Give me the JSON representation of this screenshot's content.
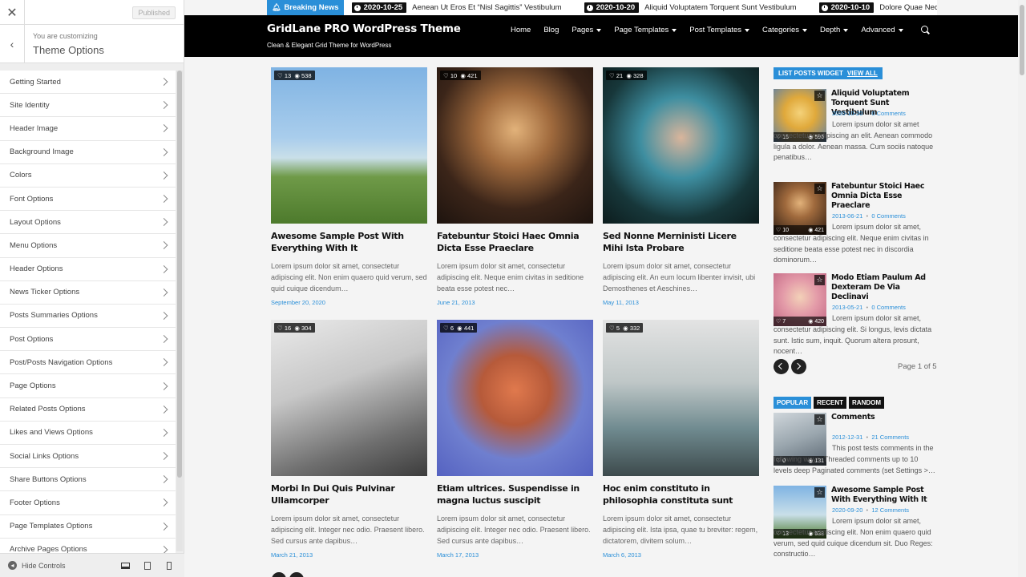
{
  "customizer": {
    "published_label": "Published",
    "subtitle": "You are customizing",
    "title": "Theme Options",
    "items": [
      "Getting Started",
      "Site Identity",
      "Header Image",
      "Background Image",
      "Colors",
      "Font Options",
      "Layout Options",
      "Menu Options",
      "Header Options",
      "News Ticker Options",
      "Posts Summaries Options",
      "Post Options",
      "Post/Posts Navigation Options",
      "Page Options",
      "Related Posts Options",
      "Likes and Views Options",
      "Social Links Options",
      "Share Buttons Options",
      "Footer Options",
      "Page Templates Options",
      "Archive Pages Options"
    ],
    "hide_controls": "Hide Controls"
  },
  "ticker": {
    "label": "Breaking News",
    "entries": [
      {
        "date": "2020-10-25",
        "text": "Aenean Ut Eros Et “Nisl Sagittis” Vestibulum"
      },
      {
        "date": "2020-10-20",
        "text": "Aliquid Voluptatem Torquent Sunt Vestibulum"
      },
      {
        "date": "2020-10-10",
        "text": "Dolore Quae Nec"
      }
    ]
  },
  "site": {
    "title": "GridLane PRO WordPress Theme",
    "description": "Clean & Elegant Grid Theme for WordPress"
  },
  "nav": [
    {
      "label": "Home",
      "dropdown": false
    },
    {
      "label": "Blog",
      "dropdown": false
    },
    {
      "label": "Pages",
      "dropdown": true
    },
    {
      "label": "Page Templates",
      "dropdown": true
    },
    {
      "label": "Post Templates",
      "dropdown": true
    },
    {
      "label": "Categories",
      "dropdown": true
    },
    {
      "label": "Depth",
      "dropdown": true
    },
    {
      "label": "Advanced",
      "dropdown": true
    }
  ],
  "posts": [
    {
      "likes": "13",
      "views": "538",
      "title": "Awesome Sample Post With Everything With It",
      "excerpt": "Lorem ipsum dolor sit amet, consectetur adipiscing elit. Non enim quaero quid verum, sed quid cuique dicendum…",
      "date": "September 20, 2020"
    },
    {
      "likes": "10",
      "views": "421",
      "title": "Fatebuntur Stoici Haec Omnia Dicta Esse Praeclare",
      "excerpt": "Lorem ipsum dolor sit amet, consectetur adipiscing elit. Neque enim civitas in seditione beata esse potest nec…",
      "date": "June 21, 2013"
    },
    {
      "likes": "21",
      "views": "328",
      "title": "Sed Nonne Merninisti Licere Mihi Ista Probare",
      "excerpt": "Lorem ipsum dolor sit amet, consectetur adipiscing elit. An eum locum libenter invisit, ubi Demosthenes et Aeschines…",
      "date": "May 11, 2013"
    },
    {
      "likes": "16",
      "views": "304",
      "title": "Morbi In Dui Quis Pulvinar Ullamcorper",
      "excerpt": "Lorem ipsum dolor sit amet, consectetur adipiscing elit. Integer nec odio. Praesent libero. Sed cursus ante dapibus…",
      "date": "March 21, 2013"
    },
    {
      "likes": "6",
      "views": "441",
      "title": "Etiam ultrices. Suspendisse in magna luctus suscipit",
      "excerpt": "Lorem ipsum dolor sit amet, consectetur adipiscing elit. Integer nec odio. Praesent libero. Sed cursus ante dapibus…",
      "date": "March 17, 2013"
    },
    {
      "likes": "5",
      "views": "332",
      "title": "Hoc enim constituto in philosophia constituta sunt",
      "excerpt": "Lorem ipsum dolor sit amet, consectetur adipiscing elit. Ista ipsa, quae tu breviter: regem, dictatorem, divitem solum…",
      "date": "March 6, 2013"
    }
  ],
  "sidebar": {
    "widget_title": "LIST POSTS WIDGET",
    "view_all": "VIEW ALL",
    "list": [
      {
        "likes": "15",
        "views": "596",
        "title": "Aliquid Voluptatem Torquent Sunt Vestibulum",
        "date": "2020-10-20",
        "comments": "0 Comments",
        "excerpt": "Lorem ipsum dolor sit amet consectetuer adipiscing an elit. Aenean commodo ligula a dolor. Aenean massa. Cum sociis natoque penatibus…"
      },
      {
        "likes": "10",
        "views": "421",
        "title": "Fatebuntur Stoici Haec Omnia Dicta Esse Praeclare",
        "date": "2013-06-21",
        "comments": "0 Comments",
        "excerpt": "Lorem ipsum dolor sit amet, consectetur adipiscing elit. Neque enim civitas in seditione beata esse potest nec in discordia dominorum…"
      },
      {
        "likes": "7",
        "views": "420",
        "title": "Modo Etiam Paulum Ad Dexteram De Via Declinavi",
        "date": "2013-05-21",
        "comments": "0 Comments",
        "excerpt": "Lorem ipsum dolor sit amet, consectetur adipiscing elit. Si longus, levis dictata sunt. Istic sum, inquit. Quorum altera prosunt, nocent…"
      }
    ],
    "page_of": "Page 1 of 5",
    "tabs": [
      "POPULAR",
      "RECENT",
      "RANDOM"
    ],
    "tab_list": [
      {
        "likes": "0",
        "views": "131",
        "title": "Comments",
        "date": "2012-12-31",
        "comments": "21 Comments",
        "excerpt": "This post tests comments in the following ways. Threaded comments up to 10 levels deep Paginated comments (set Settings >…"
      },
      {
        "likes": "13",
        "views": "538",
        "title": "Awesome Sample Post With Everything With It",
        "date": "2020-09-20",
        "comments": "12 Comments",
        "excerpt": "Lorem ipsum dolor sit amet, consectetur adipiscing elit. Non enim quaero quid verum, sed quid cuique dicendum sit. Duo Reges: constructio…"
      }
    ]
  },
  "colors": {
    "accent": "#2a8fd8",
    "header_bg": "#000000"
  }
}
